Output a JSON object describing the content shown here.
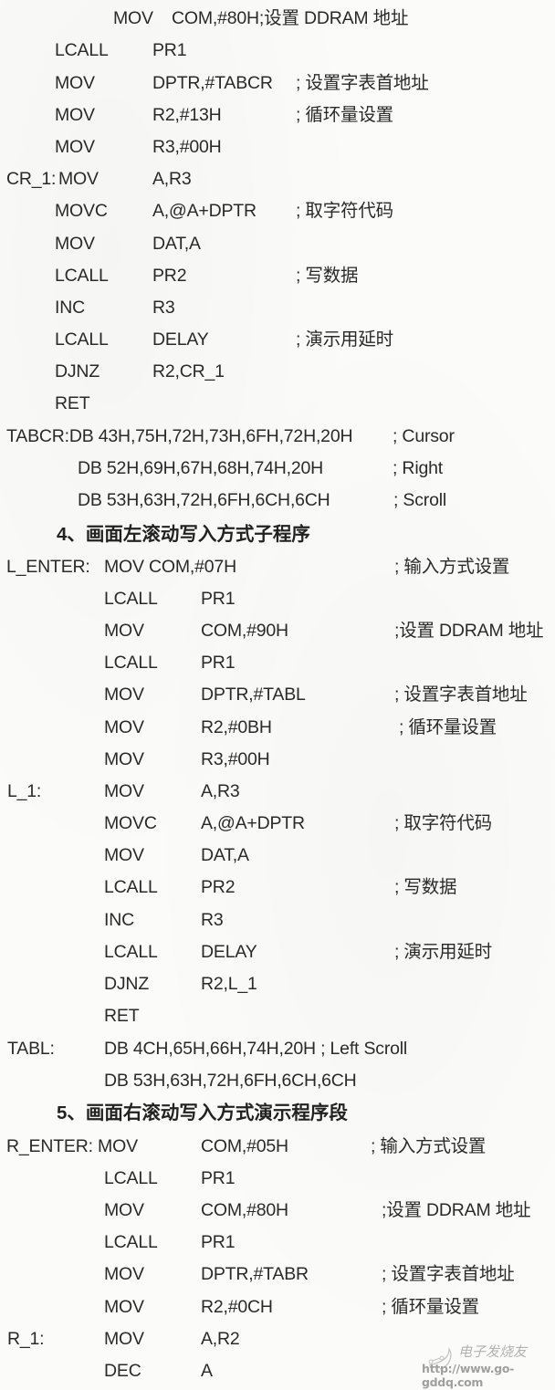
{
  "document": {
    "sections": [
      {
        "id": "cursor-right-scroll",
        "lines": [
          {
            "label": "",
            "op": "MOV",
            "args": "COM,#80H;设置 DDRAM 地址",
            "comment": ""
          },
          {
            "label": "",
            "op": "LCALL",
            "args": "PR1",
            "comment": ""
          },
          {
            "label": "",
            "op": "MOV",
            "args": "DPTR,#TABCR",
            "comment": "; 设置字表首地址"
          },
          {
            "label": "",
            "op": "MOV",
            "args": "R2,#13H",
            "comment": "; 循环量设置"
          },
          {
            "label": "",
            "op": "MOV",
            "args": "R3,#00H",
            "comment": ""
          },
          {
            "label": "CR_1:",
            "op": "MOV",
            "args": "A,R3",
            "comment": ""
          },
          {
            "label": "",
            "op": "MOVC",
            "args": "A,@A+DPTR",
            "comment": "; 取字符代码"
          },
          {
            "label": "",
            "op": "MOV",
            "args": "DAT,A",
            "comment": ""
          },
          {
            "label": "",
            "op": "LCALL",
            "args": "PR2",
            "comment": "; 写数据"
          },
          {
            "label": "",
            "op": "INC",
            "args": "R3",
            "comment": ""
          },
          {
            "label": "",
            "op": "LCALL",
            "args": "DELAY",
            "comment": "; 演示用延时"
          },
          {
            "label": "",
            "op": "DJNZ",
            "args": "R2,CR_1",
            "comment": ""
          },
          {
            "label": "",
            "op": "RET",
            "args": "",
            "comment": ""
          },
          {
            "label": "TABCR:DB 43H,75H,72H,73H,6FH,72H,20H",
            "op": "",
            "args": "",
            "comment": "; Cursor"
          },
          {
            "label": "",
            "op": "DB  52H,69H,67H,68H,74H,20H",
            "args": "",
            "comment": "; Right"
          },
          {
            "label": "",
            "op": "DB  53H,63H,72H,6FH,6CH,6CH",
            "args": "",
            "comment": "; Scroll"
          }
        ]
      },
      {
        "id": "left-scroll",
        "heading": "4、画面左滚动写入方式子程序",
        "lines": [
          {
            "label": "L_ENTER:",
            "op": "MOV COM,#07H",
            "args": "",
            "comment": "; 输入方式设置"
          },
          {
            "label": "",
            "op": "LCALL",
            "args": "PR1",
            "comment": ""
          },
          {
            "label": "",
            "op": "MOV",
            "args": "COM,#90H",
            "comment": ";设置 DDRAM 地址"
          },
          {
            "label": "",
            "op": "LCALL",
            "args": "PR1",
            "comment": ""
          },
          {
            "label": "",
            "op": "MOV",
            "args": "DPTR,#TABL",
            "comment": "; 设置字表首地址"
          },
          {
            "label": "",
            "op": "MOV",
            "args": "R2,#0BH",
            "comment": "; 循环量设置"
          },
          {
            "label": "",
            "op": "MOV",
            "args": "R3,#00H",
            "comment": ""
          },
          {
            "label": "L_1:",
            "op": "MOV",
            "args": "A,R3",
            "comment": ""
          },
          {
            "label": "",
            "op": "MOVC",
            "args": "A,@A+DPTR",
            "comment": "; 取字符代码"
          },
          {
            "label": "",
            "op": "MOV",
            "args": "DAT,A",
            "comment": ""
          },
          {
            "label": "",
            "op": "LCALL",
            "args": "PR2",
            "comment": "; 写数据"
          },
          {
            "label": "",
            "op": "INC",
            "args": "R3",
            "comment": ""
          },
          {
            "label": "",
            "op": "LCALL",
            "args": "DELAY",
            "comment": "; 演示用延时"
          },
          {
            "label": "",
            "op": "DJNZ",
            "args": "R2,L_1",
            "comment": ""
          },
          {
            "label": "",
            "op": "RET",
            "args": "",
            "comment": ""
          },
          {
            "label": "TABL:",
            "op": "DB 4CH,65H,66H,74H,20H ; Left Scroll",
            "args": "",
            "comment": ""
          },
          {
            "label": "",
            "op": "DB 53H,63H,72H,6FH,6CH,6CH",
            "args": "",
            "comment": ""
          }
        ]
      },
      {
        "id": "right-scroll",
        "heading": "5、画面右滚动写入方式演示程序段",
        "lines": [
          {
            "label": "R_ENTER: MOV",
            "op": "",
            "args": "COM,#05H",
            "comment": "; 输入方式设置"
          },
          {
            "label": "",
            "op": "LCALL",
            "args": "PR1",
            "comment": ""
          },
          {
            "label": "",
            "op": "MOV",
            "args": "COM,#80H",
            "comment": ";设置 DDRAM 地址"
          },
          {
            "label": "",
            "op": "LCALL",
            "args": "PR1",
            "comment": ""
          },
          {
            "label": "",
            "op": "MOV",
            "args": "DPTR,#TABR",
            "comment": "; 设置字表首地址"
          },
          {
            "label": "",
            "op": "MOV",
            "args": "R2,#0CH",
            "comment": "; 循环量设置"
          },
          {
            "label": "R_1:",
            "op": "MOV",
            "args": "A,R2",
            "comment": ""
          },
          {
            "label": "",
            "op": "DEC",
            "args": "A",
            "comment": ""
          }
        ]
      }
    ]
  },
  "watermark": {
    "site_name": "电子发烧友",
    "url": "http://www.go-gddq.com"
  }
}
